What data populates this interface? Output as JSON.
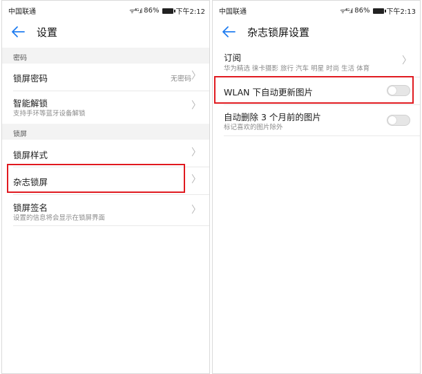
{
  "colors": {
    "accent": "#1e7cf0",
    "highlight": "#e0181e"
  },
  "left": {
    "status": {
      "carrier": "中国联通",
      "battery": "86%",
      "time": "下午2:12"
    },
    "header": {
      "title": "设置"
    },
    "sections": [
      {
        "header": "密码",
        "items": [
          {
            "title": "锁屏密码",
            "value": "无密码"
          },
          {
            "title": "智能解锁",
            "subtitle": "支持手环等蓝牙设备解锁"
          }
        ]
      },
      {
        "header": "锁屏",
        "items": [
          {
            "title": "锁屏样式"
          },
          {
            "title": "杂志锁屏"
          },
          {
            "title": "锁屏签名",
            "subtitle": "设置的信息将会显示在锁屏界面"
          }
        ]
      }
    ]
  },
  "right": {
    "status": {
      "carrier": "中国联通",
      "battery": "86%",
      "time": "下午2:13"
    },
    "header": {
      "title": "杂志锁屏设置"
    },
    "items": [
      {
        "title": "订阅",
        "subtitle": "华为精选 徕卡摄影 旅行 汽车 明星 时尚 生活 体育"
      },
      {
        "title": "WLAN 下自动更新图片",
        "toggle_on": false
      },
      {
        "title": "自动删除 3 个月前的图片",
        "subtitle": "标记喜欢的图片除外",
        "toggle_on": false
      }
    ]
  }
}
